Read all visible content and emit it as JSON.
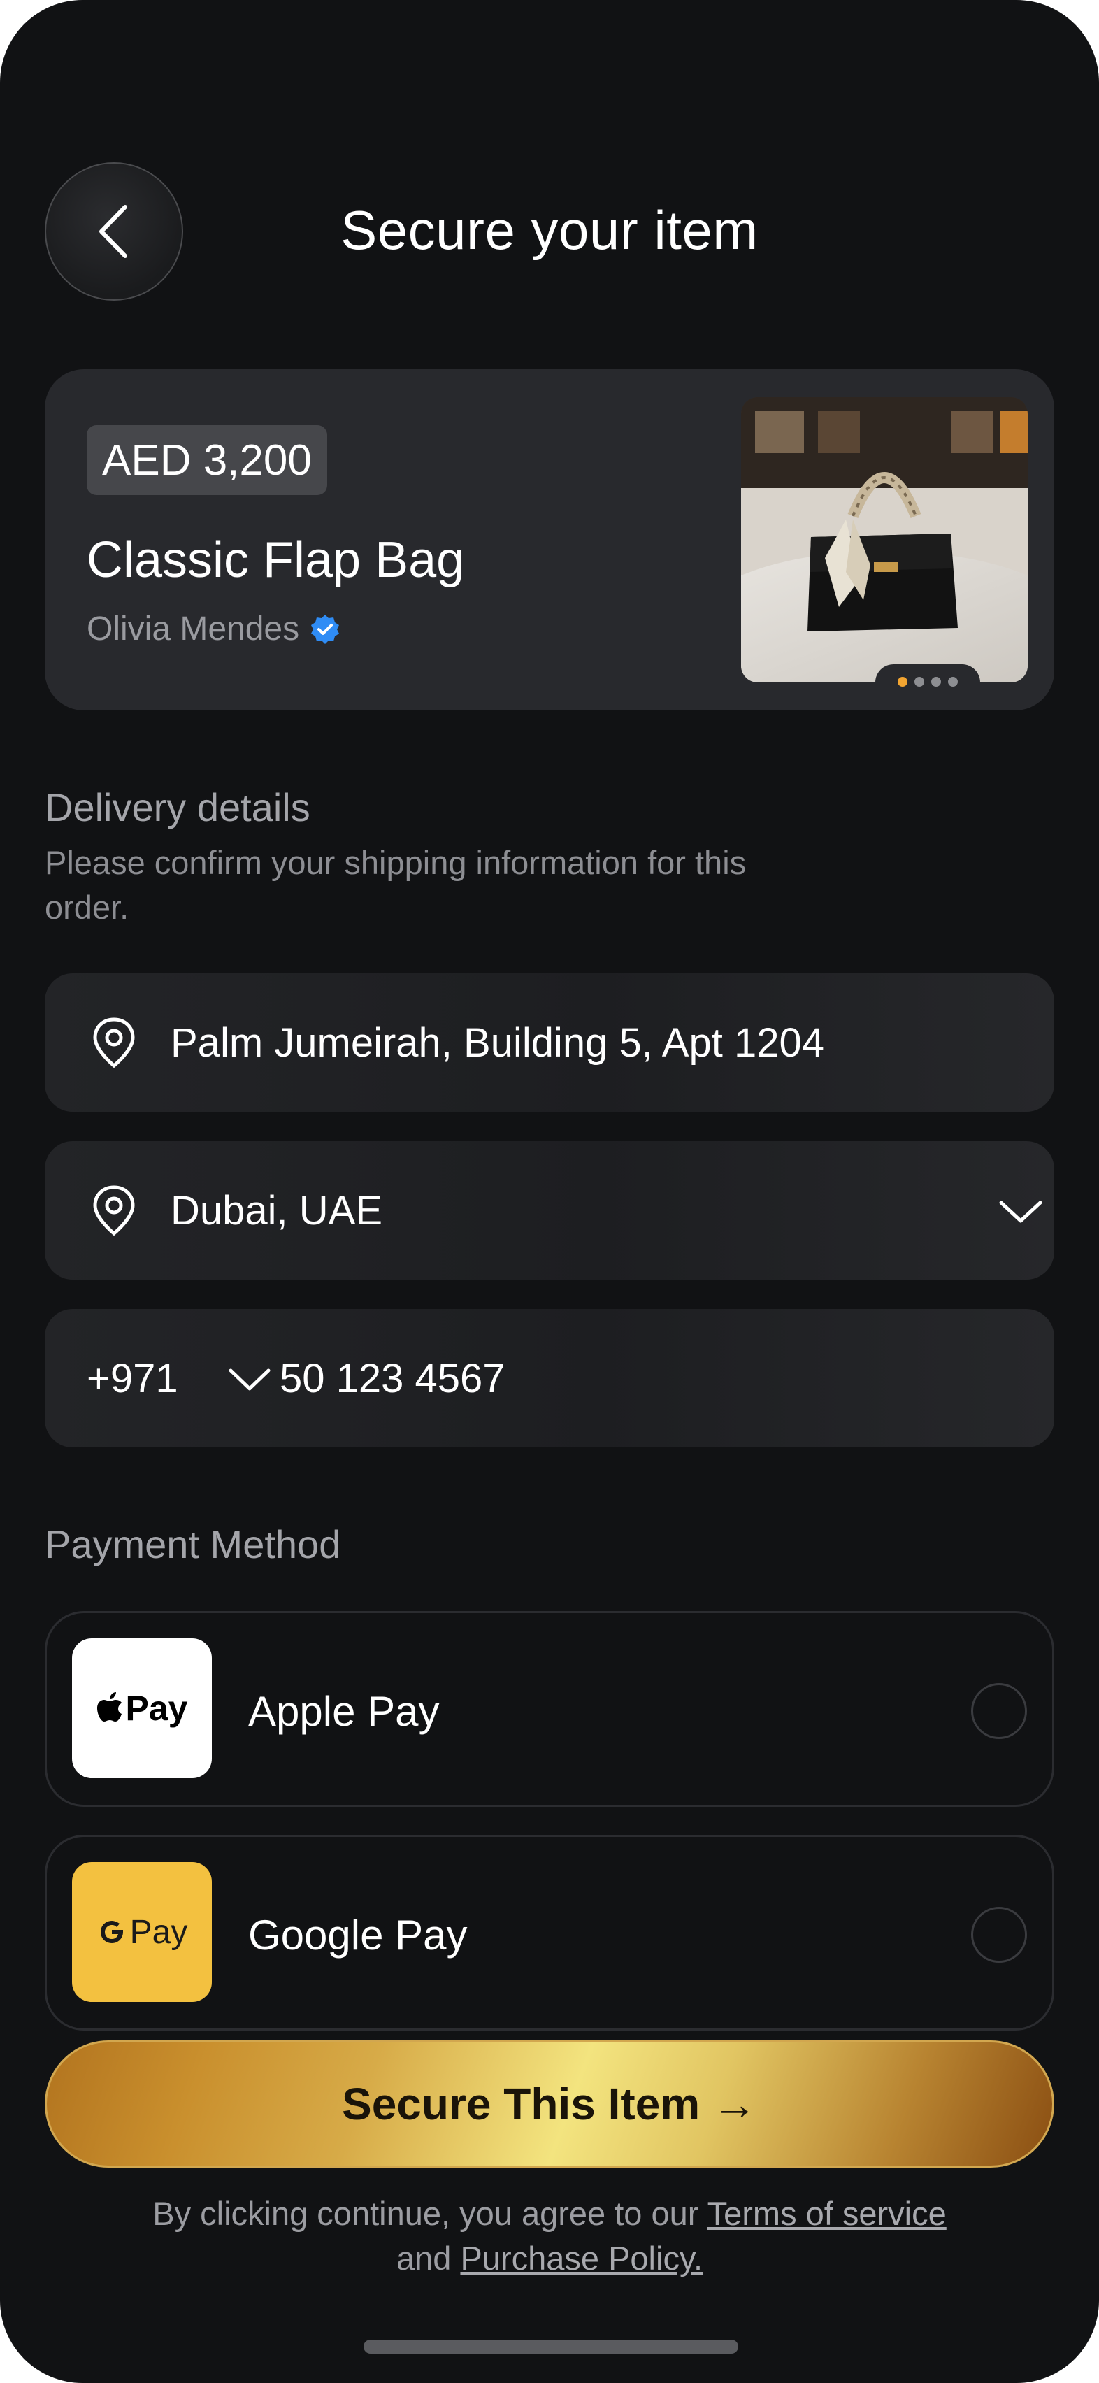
{
  "header": {
    "title": "Secure your item"
  },
  "product": {
    "price": "AED 3,200",
    "name": "Classic Flap Bag",
    "seller": "Olivia Mendes",
    "image_count": 4,
    "active_image": 1
  },
  "delivery": {
    "heading": "Delivery details",
    "subtitle": "Please confirm your shipping information for this order.",
    "address": "Palm Jumeirah, Building 5, Apt 1204",
    "city": "Dubai, UAE",
    "country_code": "+971",
    "phone": "50 123 4567"
  },
  "payment": {
    "heading": "Payment Method",
    "options": [
      {
        "label": "Apple Pay",
        "logo_text": "Pay",
        "logo_bg": "#ffffff",
        "selected": false
      },
      {
        "label": "Google Pay",
        "logo_text": "Pay",
        "logo_bg": "#f3c140",
        "selected": false
      }
    ]
  },
  "cta": {
    "label": "Secure This Item →"
  },
  "legal": {
    "prefix": "By clicking continue, you agree to our ",
    "terms": "Terms of service",
    "middle": " and ",
    "policy": "Purchase Policy."
  },
  "colors": {
    "background": "#111214",
    "card": "#28292d",
    "accent_gold": "#d7ab48",
    "verified_blue": "#2f8cf5",
    "dot_active": "#f3a531"
  }
}
